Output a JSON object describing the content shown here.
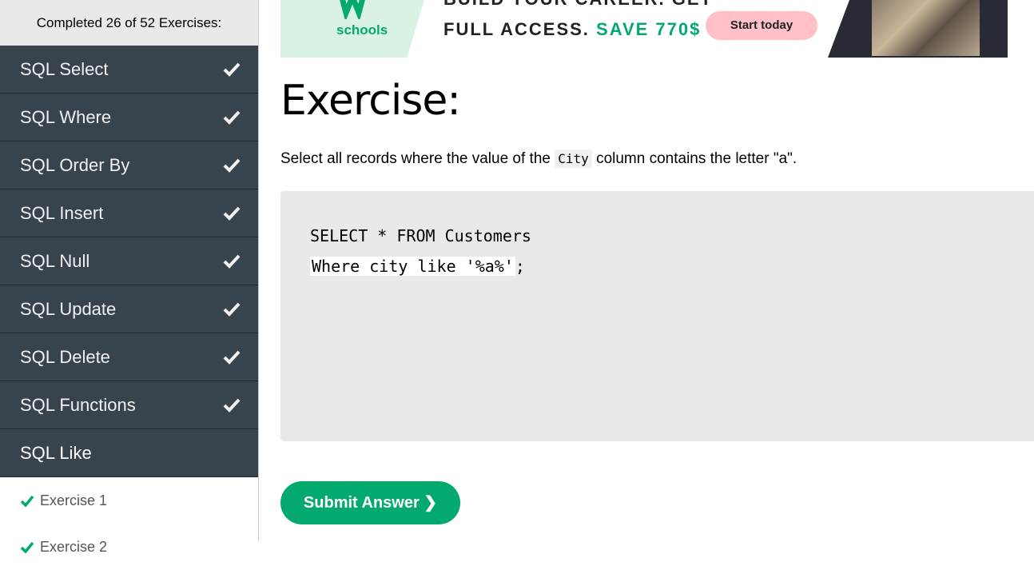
{
  "sidebar": {
    "progress": "Completed 26 of 52 Exercises:",
    "topics": [
      {
        "label": "SQL Select",
        "done": true
      },
      {
        "label": "SQL Where",
        "done": true
      },
      {
        "label": "SQL Order By",
        "done": true
      },
      {
        "label": "SQL Insert",
        "done": true
      },
      {
        "label": "SQL Null",
        "done": true
      },
      {
        "label": "SQL Update",
        "done": true
      },
      {
        "label": "SQL Delete",
        "done": true
      },
      {
        "label": "SQL Functions",
        "done": true
      },
      {
        "label": "SQL Like",
        "done": false
      }
    ],
    "exercises": [
      {
        "label": "Exercise 1",
        "done": true
      },
      {
        "label": "Exercise 2",
        "done": true
      }
    ]
  },
  "banner": {
    "logo_text": "schools",
    "line1": "BUILD YOUR CAREER. GET",
    "line2_prefix": "FULL ACCESS.",
    "line2_save": "SAVE 770$",
    "cta": "Start today"
  },
  "exercise": {
    "heading": "Exercise:",
    "instruction_before": "Select all records where the value of the",
    "instruction_code": "City",
    "instruction_after": "column contains the letter \"a\".",
    "code_line1": "SELECT * FROM Customers",
    "code_input_value": "Where city like '%a%'",
    "code_suffix": ";",
    "submit_label": "Submit Answer ❯"
  },
  "colors": {
    "sidebar_bg": "#38444d",
    "accent_green": "#04aa6d",
    "code_bg": "#e7e9eb",
    "cta_pink": "#ffc0c7"
  },
  "icons": {
    "topic_done": "checkmark-icon",
    "exercise_done": "checkmark-icon"
  }
}
